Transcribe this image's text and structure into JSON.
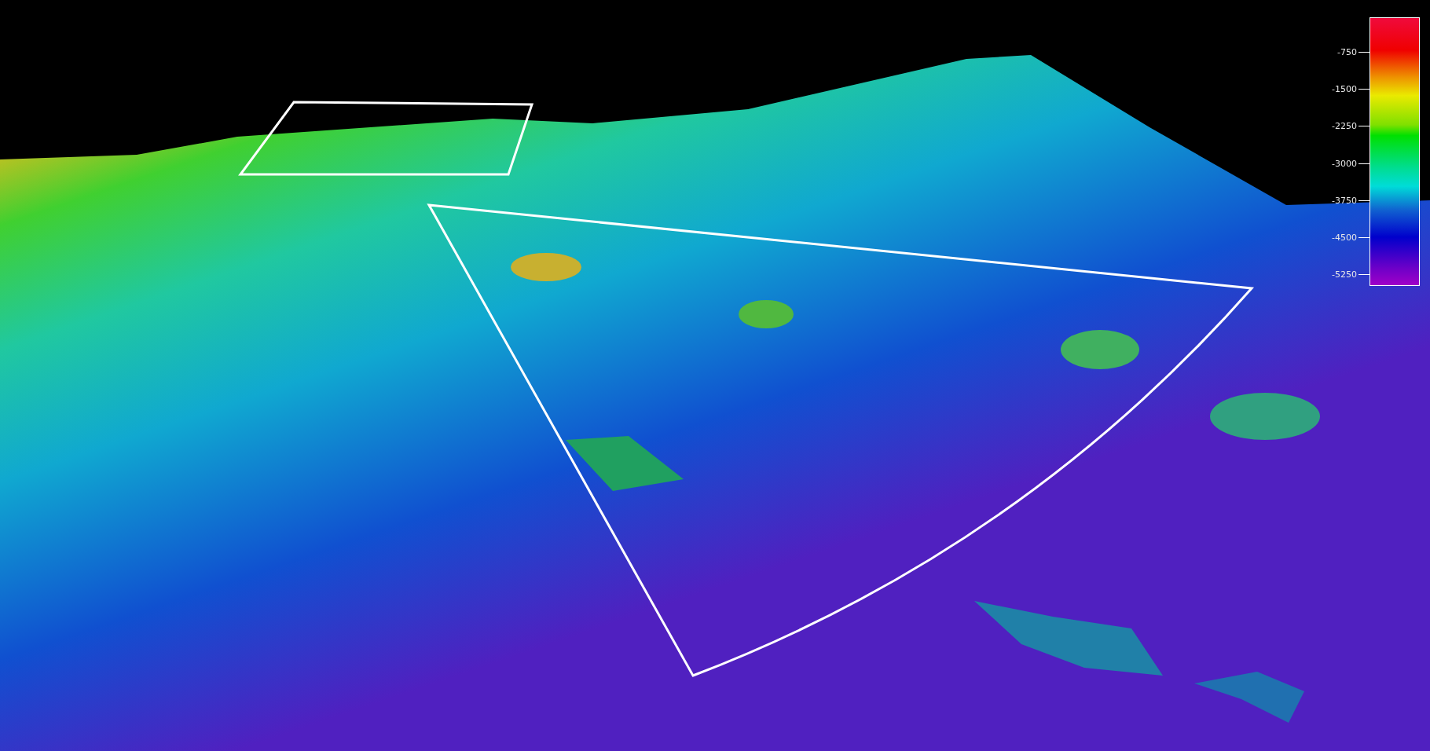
{
  "legend": {
    "labels": [
      "-750",
      "-1500",
      "-2250",
      "-3000",
      "-3750",
      "-4500",
      "-5250"
    ]
  }
}
